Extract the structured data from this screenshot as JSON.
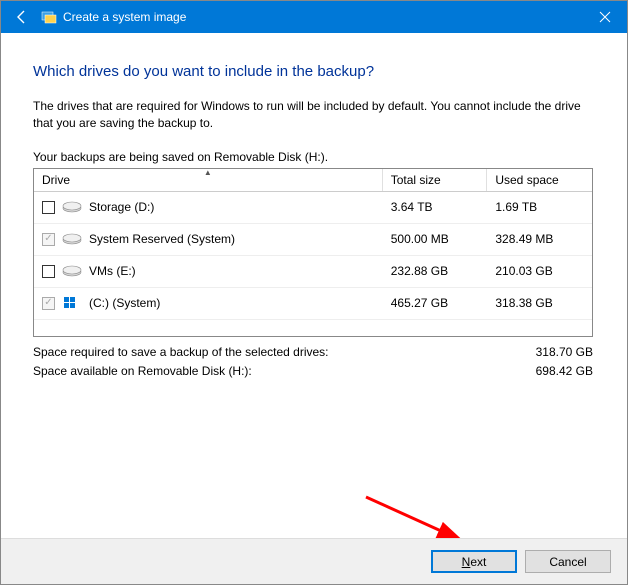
{
  "window": {
    "title": "Create a system image"
  },
  "page": {
    "heading": "Which drives do you want to include in the backup?",
    "description": "The drives that are required for Windows to run will be included by default. You cannot include the drive that you are saving the backup to.",
    "save_location": "Your backups are being saved on Removable Disk (H:)."
  },
  "columns": {
    "drive": "Drive",
    "total": "Total size",
    "used": "Used space"
  },
  "drives": [
    {
      "name": "Storage (D:)",
      "total": "3.64 TB",
      "used": "1.69 TB",
      "checked": false,
      "required": false,
      "icon": "hdd"
    },
    {
      "name": "System Reserved (System)",
      "total": "500.00 MB",
      "used": "328.49 MB",
      "checked": true,
      "required": true,
      "icon": "hdd"
    },
    {
      "name": "VMs (E:)",
      "total": "232.88 GB",
      "used": "210.03 GB",
      "checked": false,
      "required": false,
      "icon": "hdd"
    },
    {
      "name": "(C:) (System)",
      "total": "465.27 GB",
      "used": "318.38 GB",
      "checked": true,
      "required": true,
      "icon": "win"
    }
  ],
  "summary": {
    "required_label": "Space required to save a backup of the selected drives:",
    "required_value": "318.70 GB",
    "available_label": "Space available on Removable Disk (H:):",
    "available_value": "698.42 GB"
  },
  "buttons": {
    "next": "Next",
    "cancel": "Cancel"
  }
}
